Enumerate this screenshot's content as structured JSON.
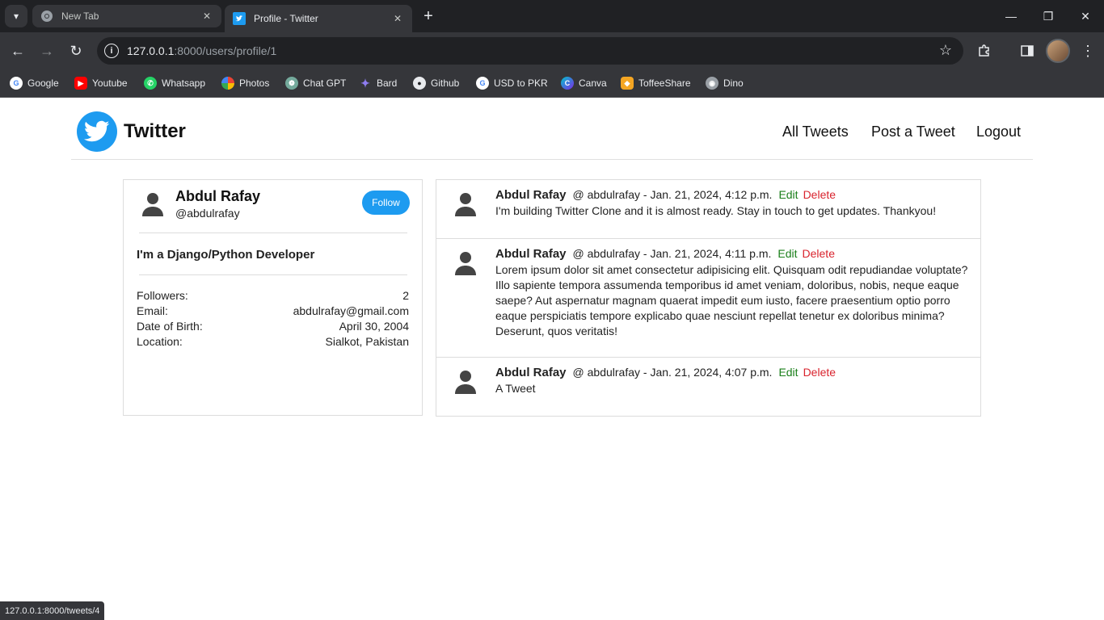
{
  "browser": {
    "tabs": [
      {
        "title": "New Tab",
        "active": false
      },
      {
        "title": "Profile - Twitter",
        "active": true
      }
    ],
    "url_host": "127.0.0.1",
    "url_rest": ":8000/users/profile/1",
    "bookmarks": [
      {
        "label": "Google",
        "icon": "google-icon",
        "color": "#ffffff"
      },
      {
        "label": "Youtube",
        "icon": "youtube-icon",
        "color": "#ff0000"
      },
      {
        "label": "Whatsapp",
        "icon": "whatsapp-icon",
        "color": "#25d366"
      },
      {
        "label": "Photos",
        "icon": "photos-icon",
        "color": "#fbbc04"
      },
      {
        "label": "Chat GPT",
        "icon": "chatgpt-icon",
        "color": "#74aa9c"
      },
      {
        "label": "Bard",
        "icon": "bard-icon",
        "color": "#8e7cf0"
      },
      {
        "label": "Github",
        "icon": "github-icon",
        "color": "#e8eaed"
      },
      {
        "label": "USD to PKR",
        "icon": "google-icon",
        "color": "#ffffff"
      },
      {
        "label": "Canva",
        "icon": "canva-icon",
        "color": "#00c4cc"
      },
      {
        "label": "ToffeeShare",
        "icon": "toffeeshare-icon",
        "color": "#f5a623"
      },
      {
        "label": "Dino",
        "icon": "dino-icon",
        "color": "#9aa0a6"
      }
    ],
    "status_url": "127.0.0.1:8000/tweets/4"
  },
  "navbar": {
    "brand": "Twitter",
    "links": [
      "All Tweets",
      "Post a Tweet",
      "Logout"
    ]
  },
  "profile": {
    "name": "Abdul Rafay",
    "handle": "@abdulrafay",
    "follow_label": "Follow",
    "bio": "I'm a Django/Python Developer",
    "details": [
      {
        "label": "Followers:",
        "value": "2"
      },
      {
        "label": "Email:",
        "value": "abdulrafay@gmail.com"
      },
      {
        "label": "Date of Birth:",
        "value": "April 30, 2004"
      },
      {
        "label": "Location:",
        "value": "Sialkot, Pakistan"
      }
    ]
  },
  "tweets": [
    {
      "author": "Abdul Rafay",
      "meta": "@ abdulrafay - Jan. 21, 2024, 4:12 p.m.",
      "edit": "Edit",
      "delete": "Delete",
      "body": "I'm building Twitter Clone and it is almost ready. Stay in touch to get updates. Thankyou!"
    },
    {
      "author": "Abdul Rafay",
      "meta": "@ abdulrafay - Jan. 21, 2024, 4:11 p.m.",
      "edit": "Edit",
      "delete": "Delete",
      "body": "Lorem ipsum dolor sit amet consectetur adipisicing elit. Quisquam odit repudiandae voluptate? Illo sapiente tempora assumenda temporibus id amet veniam, doloribus, nobis, neque eaque saepe? Aut aspernatur magnam quaerat impedit eum iusto, facere praesentium optio porro eaque perspiciatis tempore explicabo quae nesciunt repellat tenetur ex doloribus minima? Deserunt, quos veritatis!"
    },
    {
      "author": "Abdul Rafay",
      "meta": "@ abdulrafay - Jan. 21, 2024, 4:07 p.m.",
      "edit": "Edit",
      "delete": "Delete",
      "body": "A Tweet"
    }
  ]
}
